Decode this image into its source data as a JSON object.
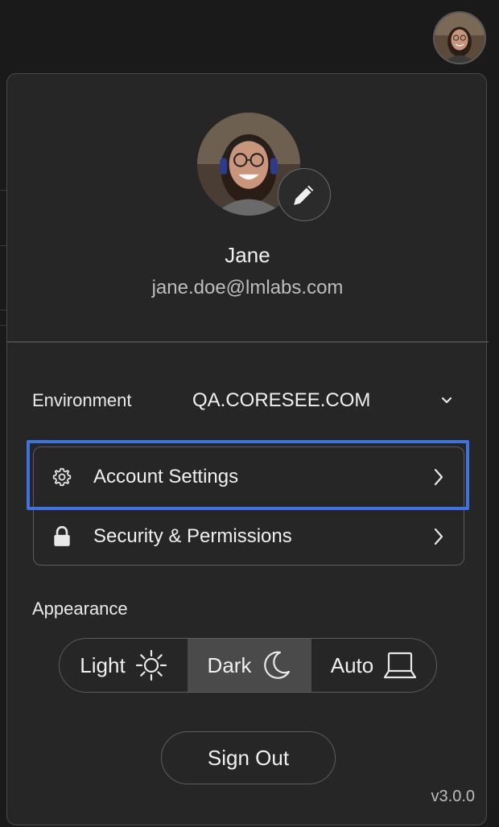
{
  "profile": {
    "name": "Jane",
    "email": "jane.doe@lmlabs.com",
    "avatar_icon": "user-photo",
    "edit_icon": "pencil-icon"
  },
  "environment": {
    "label": "Environment",
    "value": "QA.CORESEE.COM",
    "icon": "chevron-down-icon"
  },
  "menu": {
    "items": [
      {
        "label": "Account Settings",
        "icon": "gear-icon",
        "highlighted": true
      },
      {
        "label": "Security & Permissions",
        "icon": "lock-icon",
        "highlighted": false
      }
    ]
  },
  "appearance": {
    "label": "Appearance",
    "options": [
      {
        "label": "Light",
        "icon": "sun-icon"
      },
      {
        "label": "Dark",
        "icon": "moon-icon"
      },
      {
        "label": "Auto",
        "icon": "laptop-icon"
      }
    ],
    "selected": "Dark"
  },
  "signout_label": "Sign Out",
  "version": "v3.0.0",
  "colors": {
    "highlight": "#3d73e6",
    "panel": "#262627",
    "selected_segment": "#4a4a4b"
  }
}
